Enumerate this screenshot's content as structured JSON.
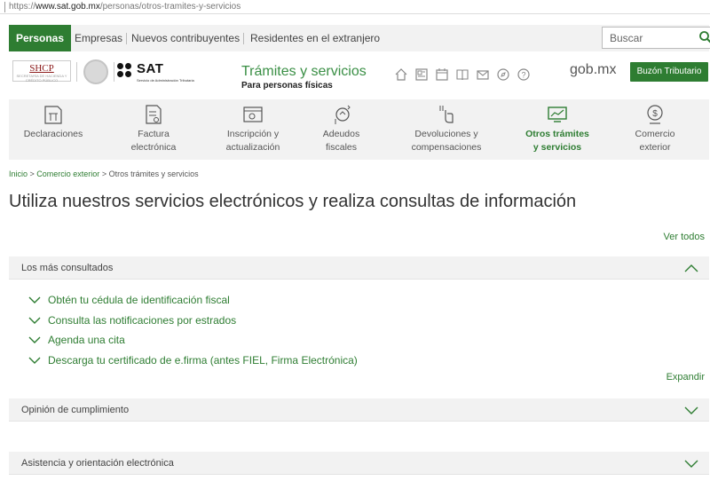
{
  "browser": {
    "url_prefix": "https://",
    "url_host": "www.sat.gob.mx",
    "url_path": "/personas/otros-tramites-y-servicios"
  },
  "topnav": {
    "tabs": [
      "Personas",
      "Empresas",
      "Nuevos contribuyentes",
      "Residentes en el extranjero"
    ],
    "search_placeholder": "Buscar"
  },
  "header": {
    "shcp": "SHCP",
    "shcp_sub": "SECRETARÍA DE HACIENDA Y CRÉDITO PÚBLICO",
    "sat": "SAT",
    "sat_sub": "Servicio de Administración Tributaria",
    "title": "Trámites y servicios",
    "subtitle": "Para personas físicas",
    "gobmx": "gob.mx",
    "buzon": "Buzón Tributario"
  },
  "categories": [
    {
      "line1": "Declaraciones",
      "line2": "",
      "icon": "declaraciones-icon"
    },
    {
      "line1": "Factura",
      "line2": "electrónica",
      "icon": "factura-icon"
    },
    {
      "line1": "Inscripción y",
      "line2": "actualización",
      "icon": "inscripcion-icon"
    },
    {
      "line1": "Adeudos",
      "line2": "fiscales",
      "icon": "adeudos-icon"
    },
    {
      "line1": "Devoluciones y",
      "line2": "compensaciones",
      "icon": "devoluciones-icon"
    },
    {
      "line1": "Otros trámites",
      "line2": "y servicios",
      "icon": "otros-tramites-icon"
    },
    {
      "line1": "Comercio",
      "line2": "exterior",
      "icon": "comercio-icon"
    }
  ],
  "breadcrumb": {
    "inicio": "Inicio",
    "sep": " > ",
    "comercio": "Comercio exterior",
    "current": "Otros trámites y servicios"
  },
  "page_title": "Utiliza nuestros servicios electrónicos y realiza consultas de información",
  "ver_todos": "Ver todos",
  "sections": {
    "mas_consultados": "Los más consultados",
    "opinion": "Opinión de cumplimiento",
    "asistencia": "Asistencia y orientación electrónica"
  },
  "items": [
    "Obtén tu cédula de identificación fiscal",
    "Consulta las notificaciones por estrados",
    "Agenda una cita",
    "Descarga tu certificado de e.firma (antes FIEL, Firma Electrónica)"
  ],
  "expandir": "Expandir",
  "colors": {
    "brand_green": "#2e7d32",
    "light_gray": "#f2f2f2"
  }
}
